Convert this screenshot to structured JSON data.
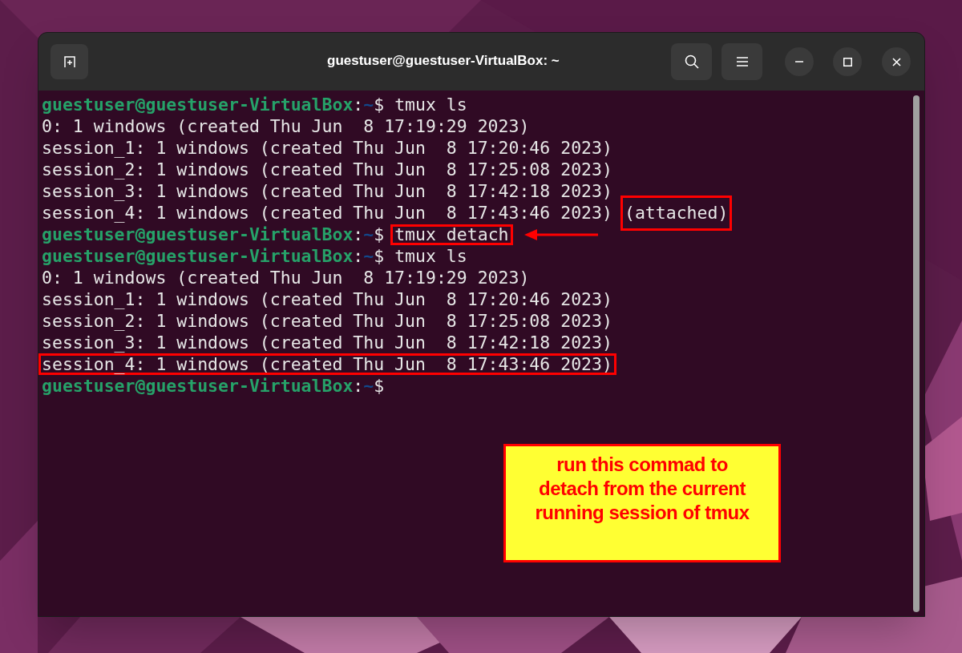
{
  "window": {
    "title": "guestuser@guestuser-VirtualBox: ~"
  },
  "terminal": {
    "lines": [
      {
        "kind": "prompt",
        "user_host": "guestuser@guestuser-VirtualBox",
        "separator": ":",
        "path": "~",
        "symbol": "$",
        "command": "tmux ls"
      },
      {
        "kind": "output",
        "text": "0: 1 windows (created Thu Jun  8 17:19:29 2023)"
      },
      {
        "kind": "output",
        "text": "session_1: 1 windows (created Thu Jun  8 17:20:46 2023)"
      },
      {
        "kind": "output",
        "text": "session_2: 1 windows (created Thu Jun  8 17:25:08 2023)"
      },
      {
        "kind": "output",
        "text": "session_3: 1 windows (created Thu Jun  8 17:42:18 2023)"
      },
      {
        "kind": "output",
        "text": "session_4: 1 windows (created Thu Jun  8 17:43:46 2023)",
        "tag": "(attached)",
        "tag_boxed": true
      },
      {
        "kind": "prompt",
        "user_host": "guestuser@guestuser-VirtualBox",
        "separator": ":",
        "path": "~",
        "symbol": "$",
        "command": "tmux detach",
        "boxed": true,
        "arrow": true
      },
      {
        "kind": "prompt",
        "user_host": "guestuser@guestuser-VirtualBox",
        "separator": ":",
        "path": "~",
        "symbol": "$",
        "command": "tmux ls"
      },
      {
        "kind": "output",
        "text": "0: 1 windows (created Thu Jun  8 17:19:29 2023)"
      },
      {
        "kind": "output",
        "text": "session_1: 1 windows (created Thu Jun  8 17:20:46 2023)"
      },
      {
        "kind": "output",
        "text": "session_2: 1 windows (created Thu Jun  8 17:25:08 2023)"
      },
      {
        "kind": "output",
        "text": "session_3: 1 windows (created Thu Jun  8 17:42:18 2023)"
      },
      {
        "kind": "output",
        "text": "session_4: 1 windows (created Thu Jun  8 17:43:46 2023)",
        "boxed": true
      },
      {
        "kind": "prompt",
        "user_host": "guestuser@guestuser-VirtualBox",
        "separator": ":",
        "path": "~",
        "symbol": "$"
      }
    ]
  },
  "note": {
    "text": "run this commad to detach from the current running session of tmux"
  }
}
